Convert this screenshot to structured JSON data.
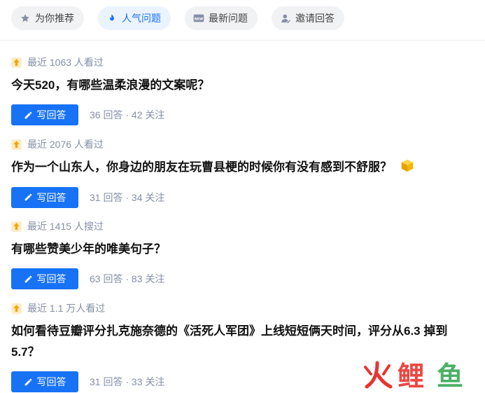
{
  "tabs": [
    {
      "label": "为你推荐",
      "icon": "star-icon"
    },
    {
      "label": "人气问题",
      "icon": "flame-icon"
    },
    {
      "label": "最新问题",
      "icon": "new-icon"
    },
    {
      "label": "邀请回答",
      "icon": "invite-user-icon"
    }
  ],
  "colors": {
    "accent": "#1772f6",
    "meta": "#8590a6",
    "hot": "#f4a300"
  },
  "questions": [
    {
      "meta": "最近 1063 人看过",
      "title": "今天520，有哪些温柔浪漫的文案呢？",
      "button": "写回答",
      "stats": "36 回答 · 42 关注"
    },
    {
      "meta": "最近 2076 人看过",
      "title": "作为一个山东人，你身边的朋友在玩曹县梗的时候你有没有感到不舒服？",
      "button": "写回答",
      "stats": "31 回答 · 34 关注"
    },
    {
      "meta": "最近 1415 人搜过",
      "title": "有哪些赞美少年的唯美句子？",
      "button": "写回答",
      "stats": "63 回答 · 83 关注"
    },
    {
      "meta": "最近 1.1 万人看过",
      "title": "如何看待豆瓣评分扎克施奈德的《活死人军团》上线短短俩天时间，评分从6.3 掉到5.7？",
      "button": "写回答",
      "stats": "31 回答 · 33 关注"
    }
  ],
  "watermark": "鲤鱼"
}
